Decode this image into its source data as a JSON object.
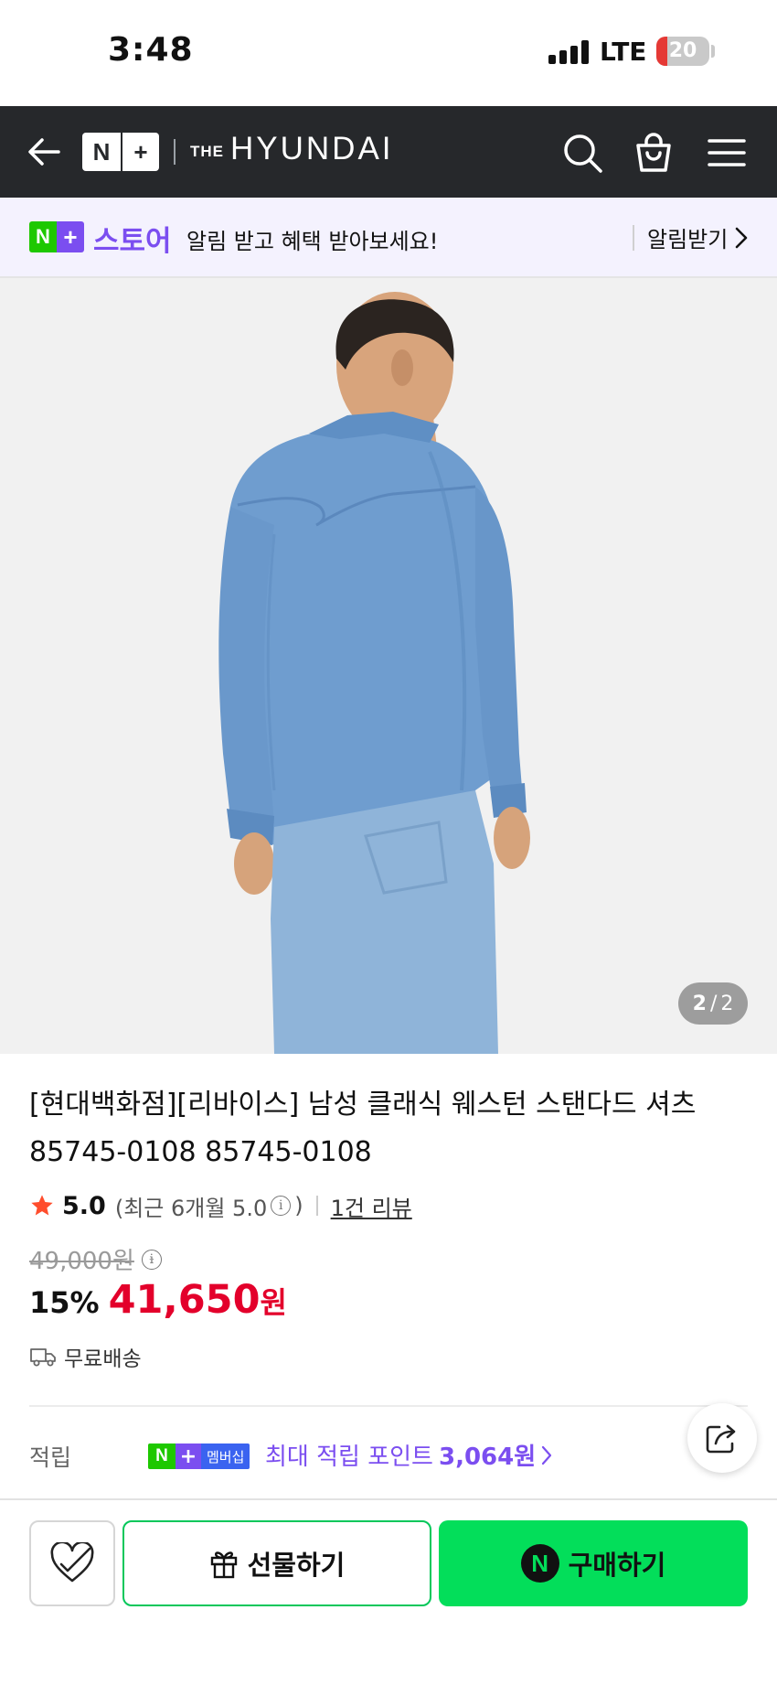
{
  "status_bar": {
    "time": "3:48",
    "network": "LTE",
    "battery": "20",
    "battery_level": 0.2
  },
  "header": {
    "brand_badge_n": "N",
    "brand_badge_plus": "+",
    "brand_prefix": "THE",
    "brand_name": "HYUNDAI",
    "icons": [
      "back-arrow-icon",
      "search-icon",
      "shopping-bag-icon",
      "menu-icon"
    ]
  },
  "store_banner": {
    "badge_n": "N",
    "badge_plus": "+",
    "store_label": "스토어",
    "message": "알림 받고 혜택 받아보세요!",
    "action_label": "알림받기"
  },
  "gallery": {
    "current": "2",
    "separator": "/",
    "total": "2"
  },
  "product": {
    "title": "[현대백화점][리바이스] 남성 클래식 웨스턴 스탠다드 셔츠 85745-0108 85745-0108",
    "rating": "5.0",
    "recent_rating_prefix": "(최근 6개월 5.0",
    "recent_rating_suffix": ")",
    "info_glyph": "i",
    "review_link": "1건 리뷰",
    "original_price": "49,000원",
    "discount_rate": "15%",
    "sale_price": "41,650",
    "currency": "원",
    "shipping": "무료배송"
  },
  "points": {
    "label": "적립",
    "badge_n": "N",
    "badge_plus": "+",
    "badge_membership": "멤버십",
    "text": "최대 적립 포인트",
    "amount": "3,064원"
  },
  "bottom_bar": {
    "gift_label": "선물하기",
    "buy_badge": "N",
    "buy_label": "구매하기"
  },
  "colors": {
    "header_bg": "#26282b",
    "naver_green": "#03de5a",
    "plus_purple": "#7b4ef0",
    "sale_red": "#e3002b",
    "banner_bg": "#f4f2fe"
  }
}
